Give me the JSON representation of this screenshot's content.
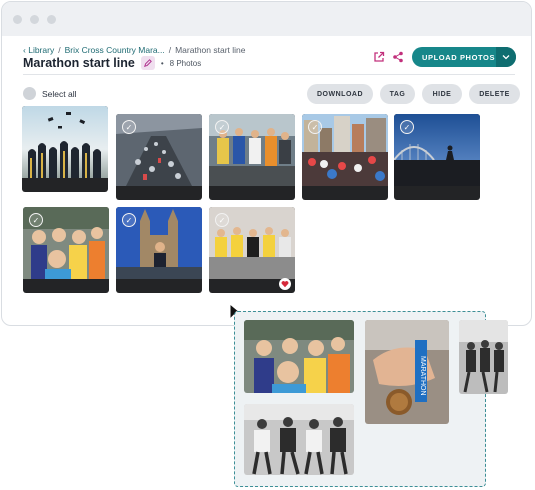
{
  "window": {
    "breadcrumb": {
      "library": "Library",
      "parent": "Brix Cross Country Mara...",
      "separator": "/",
      "current": "Marathon start line"
    },
    "title": "Marathon start line",
    "photo_count": "8 Photos",
    "count_dot": "•",
    "upload_label": "UPLOAD PHOTOS",
    "select_all_label": "Select all",
    "actions": [
      "DOWNLOAD",
      "TAG",
      "HIDE",
      "DELETE"
    ]
  },
  "photos": [
    {
      "subject": "graduation caps thrown in air",
      "selected": false
    },
    {
      "subject": "marathon runners on street",
      "selected": true
    },
    {
      "subject": "runners in race",
      "selected": true
    },
    {
      "subject": "crowd of runners in city",
      "selected": true
    },
    {
      "subject": "runner on bridge",
      "selected": true
    },
    {
      "subject": "smiling runners",
      "selected": true
    },
    {
      "subject": "runner near cathedral",
      "selected": true
    },
    {
      "subject": "runners on track",
      "selected": true
    }
  ],
  "dragged_photos": [
    "smiling runners (color)",
    "hand holding medal",
    "runners (black and white)",
    "runners running (black and white)"
  ],
  "medal_ribbon_text": "MARATHON",
  "icons": {
    "breadcrumb_back": "chevron-left-icon",
    "edit": "pencil-icon",
    "open": "external-link-icon",
    "share": "share-icon",
    "upload_menu": "chevron-down-icon",
    "checkbox": "check-circle-icon",
    "favorite": "heart-icon",
    "cursor": "mouse-pointer-icon"
  },
  "colors": {
    "accent": "#17878a",
    "link": "#1f6b73",
    "edit_icon": "#b0328f",
    "favorite": "#d6293a",
    "dropzone_border": "#3c8f96"
  }
}
